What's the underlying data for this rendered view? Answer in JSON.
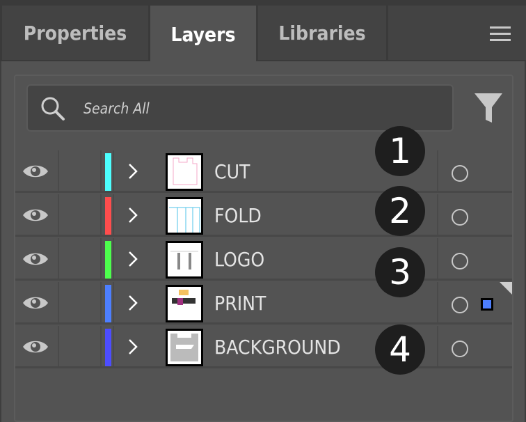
{
  "tabs": [
    {
      "label": "Properties",
      "active": false
    },
    {
      "label": "Layers",
      "active": true
    },
    {
      "label": "Libraries",
      "active": false
    }
  ],
  "menu_icon": "hamburger-icon",
  "search": {
    "placeholder": "Search All",
    "value": "",
    "icon": "search-icon"
  },
  "filter_icon": "filter-icon",
  "layers": [
    {
      "name": "CUT",
      "color": "#4dffff",
      "visible": true,
      "selected": false
    },
    {
      "name": "FOLD",
      "color": "#ff4d4d",
      "visible": true,
      "selected": false
    },
    {
      "name": "LOGO",
      "color": "#4dff4d",
      "visible": true,
      "selected": false
    },
    {
      "name": "PRINT",
      "color": "#4d7fff",
      "visible": true,
      "selected": true
    },
    {
      "name": "BACKGROUND",
      "color": "#4d4dff",
      "visible": true,
      "selected": false
    }
  ],
  "badges": [
    "1",
    "2",
    "3",
    "4"
  ]
}
